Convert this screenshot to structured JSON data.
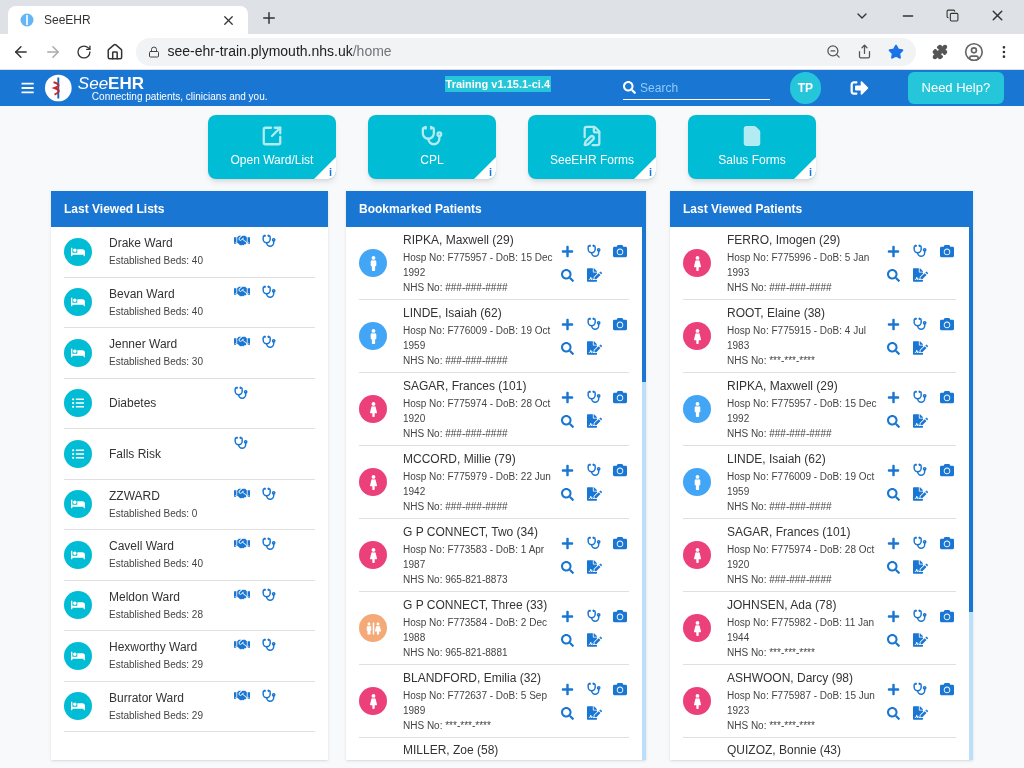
{
  "browser": {
    "tab_title": "SeeEHR",
    "url": {
      "host": "see-ehr-train.plymouth.nhs.uk",
      "path": "/home"
    }
  },
  "header": {
    "logo_see": "See",
    "logo_ehr": "EHR",
    "tagline": "Connecting patients, clinicians and you.",
    "version": "Training v1.15.1-ci.4",
    "search": {
      "placeholder": "Search"
    },
    "avatar": "TP",
    "help_button": "Need Help?"
  },
  "tiles": [
    {
      "kind": "open",
      "label": "Open Ward/List",
      "info": "i"
    },
    {
      "kind": "cpl",
      "label": "CPL",
      "info": "i"
    },
    {
      "kind": "forms",
      "label": "SeeEHR Forms",
      "info": "i"
    },
    {
      "kind": "salus",
      "label": "Salus Forms",
      "info": "i"
    }
  ],
  "last_viewed_lists": {
    "title": "Last Viewed Lists",
    "items": [
      {
        "kind": "ward",
        "name": "Drake Ward",
        "beds": "Established Beds: 40"
      },
      {
        "kind": "ward",
        "name": "Bevan Ward",
        "beds": "Established Beds: 40"
      },
      {
        "kind": "ward",
        "name": "Jenner Ward",
        "beds": "Established Beds: 30"
      },
      {
        "kind": "list",
        "name": "Diabetes"
      },
      {
        "kind": "list",
        "name": "Falls Risk"
      },
      {
        "kind": "ward",
        "name": "ZZWARD",
        "beds": "Established Beds: 0"
      },
      {
        "kind": "ward",
        "name": "Cavell Ward",
        "beds": "Established Beds: 40"
      },
      {
        "kind": "ward",
        "name": "Meldon Ward",
        "beds": "Established Beds: 28"
      },
      {
        "kind": "ward",
        "name": "Hexworthy Ward",
        "beds": "Established Beds: 29"
      },
      {
        "kind": "ward",
        "name": "Burrator Ward",
        "beds": "Established Beds: 29"
      }
    ]
  },
  "bookmarked_patients": {
    "title": "Bookmarked Patients",
    "patients": [
      {
        "kind": "male",
        "name": "RIPKA, Maxwell (29)",
        "details": "Hosp No: F775957 - DoB: 15 Dec 1992",
        "nhs": "NHS No: ###-###-####"
      },
      {
        "kind": "male",
        "name": "LINDE, Isaiah (62)",
        "details": "Hosp No: F776009 - DoB: 19 Oct 1959",
        "nhs": "NHS No: ###-###-####"
      },
      {
        "kind": "female",
        "name": "SAGAR, Frances (101)",
        "details": "Hosp No: F775974 - DoB: 28 Oct 1920",
        "nhs": "NHS No: ###-###-####"
      },
      {
        "kind": "female",
        "name": "MCCORD, Millie (79)",
        "details": "Hosp No: F775979 - DoB: 22 Jun 1942",
        "nhs": "NHS No: ###-###-####"
      },
      {
        "kind": "female",
        "name": "G P CONNECT, Two (34)",
        "details": "Hosp No: F773583 - DoB: 1 Apr 1987",
        "nhs": "NHS No: 965-821-8873"
      },
      {
        "kind": "unknown",
        "name": "G P CONNECT, Three (33)",
        "details": "Hosp No: F773584 - DoB: 2 Dec 1988",
        "nhs": "NHS No: 965-821-8881"
      },
      {
        "kind": "female",
        "name": "BLANDFORD, Emilia (32)",
        "details": "Hosp No: F772637 - DoB: 5 Sep 1989",
        "nhs": "NHS No: ***-***-****"
      },
      {
        "kind": "partial",
        "name": "MILLER, Zoe (58)"
      }
    ]
  },
  "last_viewed_patients": {
    "title": "Last Viewed Patients",
    "patients": [
      {
        "kind": "female",
        "name": "FERRO, Imogen (29)",
        "details": "Hosp No: F775996 - DoB: 5 Jan 1993",
        "nhs": "NHS No: ###-###-####"
      },
      {
        "kind": "female",
        "name": "ROOT, Elaine (38)",
        "details": "Hosp No: F775915 - DoB: 4 Jul 1983",
        "nhs": "NHS No: ***-***-****"
      },
      {
        "kind": "male",
        "name": "RIPKA, Maxwell (29)",
        "details": "Hosp No: F775957 - DoB: 15 Dec 1992",
        "nhs": "NHS No: ###-###-####"
      },
      {
        "kind": "male",
        "name": "LINDE, Isaiah (62)",
        "details": "Hosp No: F776009 - DoB: 19 Oct 1959",
        "nhs": "NHS No: ###-###-####"
      },
      {
        "kind": "female",
        "name": "SAGAR, Frances (101)",
        "details": "Hosp No: F775974 - DoB: 28 Oct 1920",
        "nhs": "NHS No: ###-###-####"
      },
      {
        "kind": "female",
        "name": "JOHNSEN, Ada (78)",
        "details": "Hosp No: F775982 - DoB: 11 Jan 1944",
        "nhs": "NHS No: ***-***-****"
      },
      {
        "kind": "female",
        "name": "ASHWOON, Darcy (98)",
        "details": "Hosp No: F775987 - DoB: 15 Jun 1923",
        "nhs": "NHS No: ***-***-****"
      },
      {
        "kind": "partial",
        "name": "QUIZOZ, Bonnie (43)"
      }
    ]
  }
}
